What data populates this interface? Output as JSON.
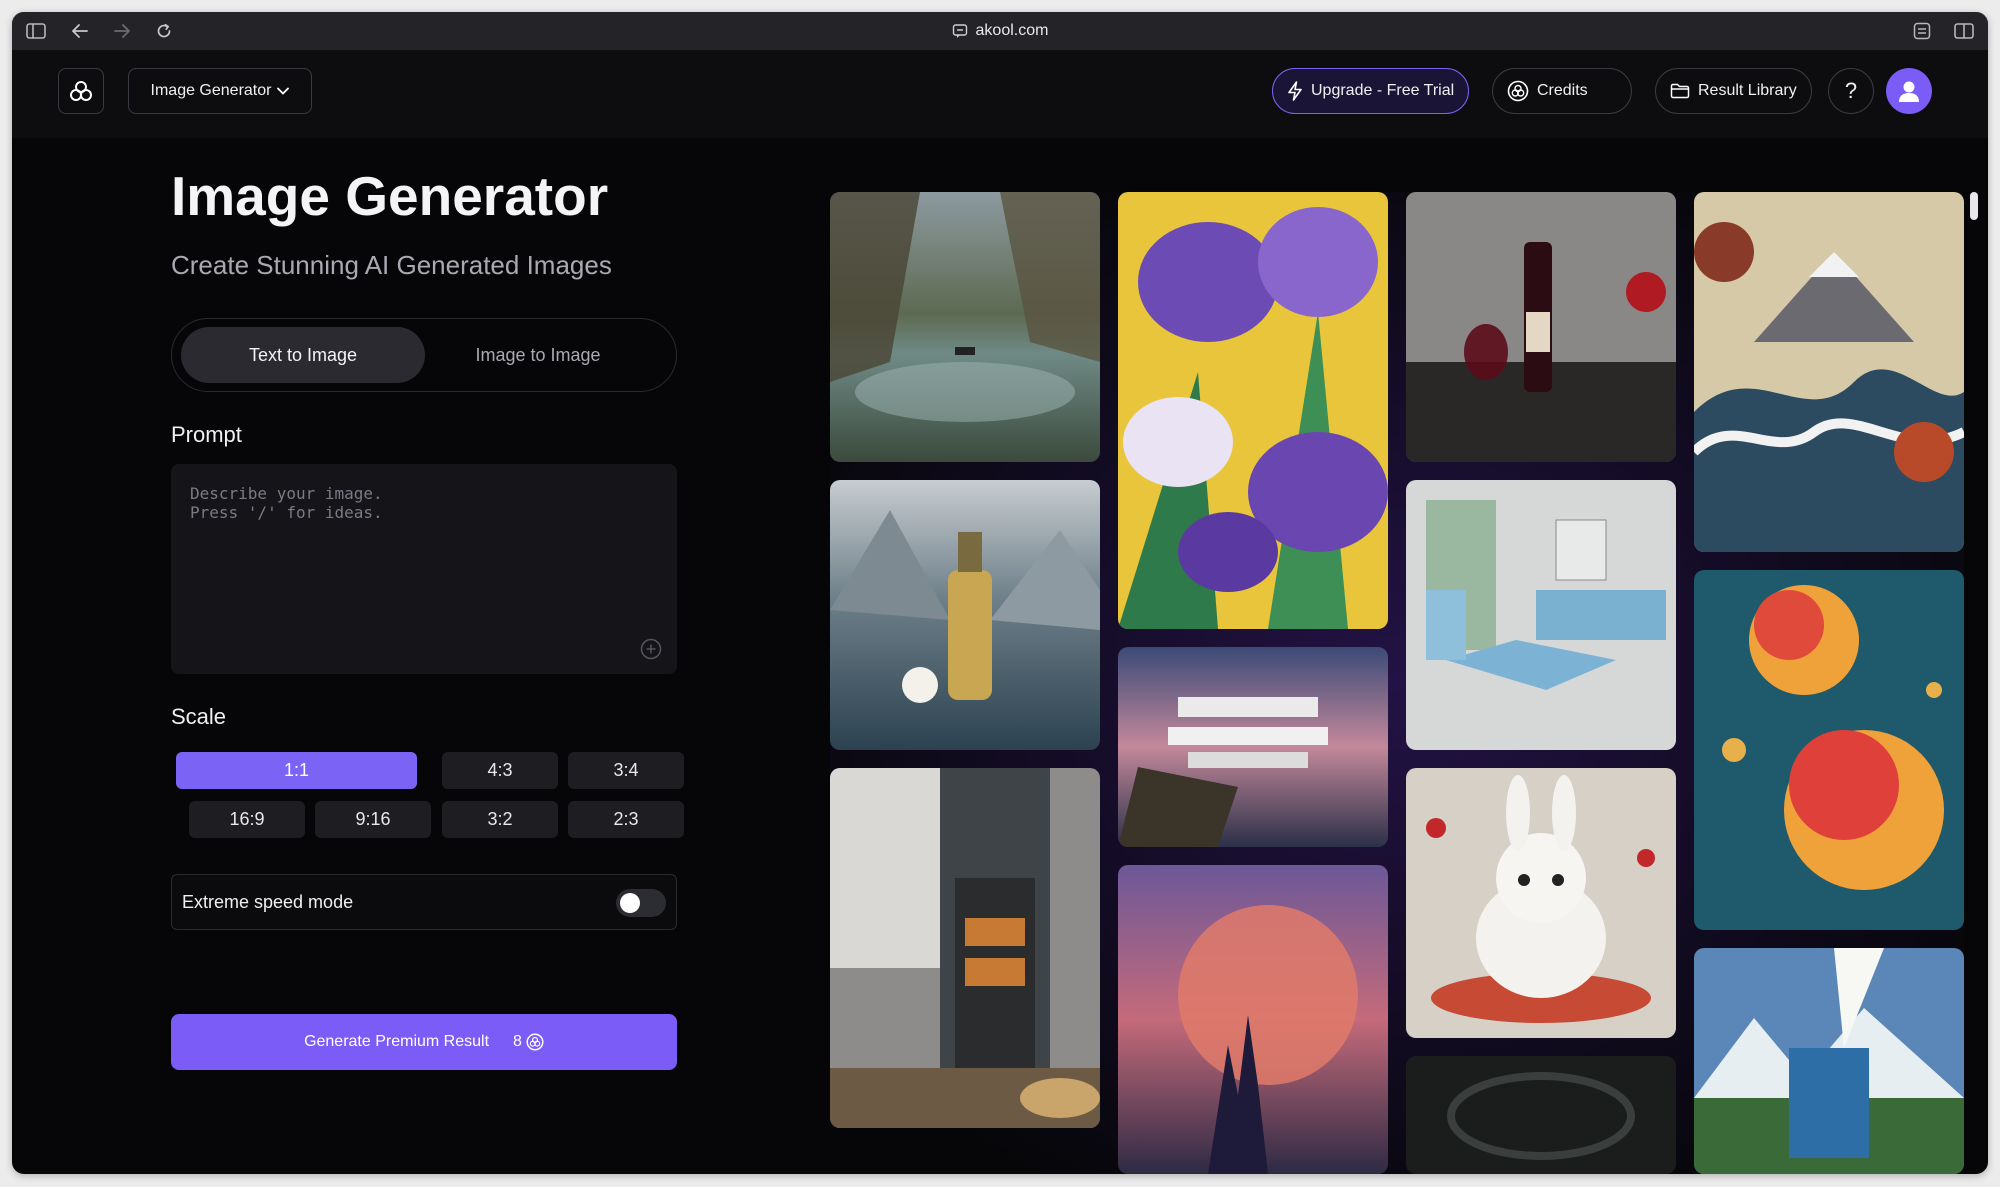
{
  "browser": {
    "url": "akool.com"
  },
  "header": {
    "tool_select": "Image Generator",
    "upgrade_label": "Upgrade - Free Trial",
    "credits_label": "Credits",
    "library_label": "Result Library",
    "help_label": "?"
  },
  "page": {
    "title": "Image Generator",
    "subtitle": "Create Stunning AI Generated Images",
    "tabs": [
      {
        "label": "Text to Image",
        "active": true
      },
      {
        "label": "Image to Image",
        "active": false
      }
    ],
    "prompt_label": "Prompt",
    "prompt_placeholder": "Describe your image.\nPress '/' for ideas.",
    "prompt_value": "",
    "scale_label": "Scale",
    "scales": [
      "1:1",
      "4:3",
      "3:4",
      "16:9",
      "9:16",
      "3:2",
      "2:3"
    ],
    "selected_scale": "1:1",
    "speed_label": "Extreme speed mode",
    "speed_enabled": false,
    "generate_label": "Generate Premium Result",
    "generate_cost": "8"
  },
  "gallery": [
    {
      "subject": "mountain lake with boat"
    },
    {
      "subject": "purple iris flowers"
    },
    {
      "subject": "red wine bottle and glass"
    },
    {
      "subject": "great wave and mount fuji"
    },
    {
      "subject": "perfume bottle by lake"
    },
    {
      "subject": "modern cliffside house"
    },
    {
      "subject": "blue living room"
    },
    {
      "subject": "peaches splashing in water"
    },
    {
      "subject": "kitchen oven with bread"
    },
    {
      "subject": "red planet fantasy castle"
    },
    {
      "subject": "white rabbit figurine"
    },
    {
      "subject": "dark glass bowl"
    },
    {
      "subject": "milk splash on mountains"
    }
  ],
  "colors": {
    "accent": "#7b5cf6",
    "background": "#060608",
    "panel": "#141419"
  }
}
